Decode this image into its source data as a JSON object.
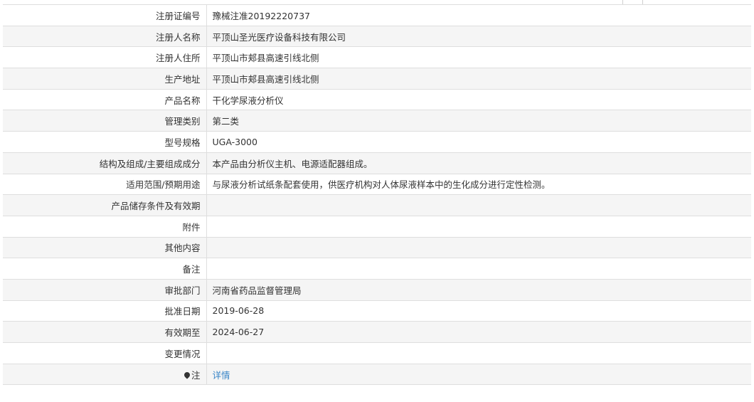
{
  "rows": [
    {
      "label": "注册证编号",
      "value": "豫械注准20192220737"
    },
    {
      "label": "注册人名称",
      "value": "平顶山圣光医疗设备科技有限公司"
    },
    {
      "label": "注册人住所",
      "value": "平顶山市郏县高速引线北侧"
    },
    {
      "label": "生产地址",
      "value": "平顶山市郏县高速引线北侧"
    },
    {
      "label": "产品名称",
      "value": "干化学尿液分析仪"
    },
    {
      "label": "管理类别",
      "value": "第二类"
    },
    {
      "label": "型号规格",
      "value": "UGA-3000"
    },
    {
      "label": "结构及组成/主要组成成分",
      "value": "本产品由分析仪主机、电源适配器组成。"
    },
    {
      "label": "适用范围/预期用途",
      "value": "与尿液分析试纸条配套使用，供医疗机构对人体尿液样本中的生化成分进行定性检测。"
    },
    {
      "label": "产品储存条件及有效期",
      "value": ""
    },
    {
      "label": "附件",
      "value": ""
    },
    {
      "label": "其他内容",
      "value": ""
    },
    {
      "label": "备注",
      "value": ""
    },
    {
      "label": "审批部门",
      "value": "河南省药品监督管理局"
    },
    {
      "label": "批准日期",
      "value": "2019-06-28"
    },
    {
      "label": "有效期至",
      "value": "2024-06-27"
    },
    {
      "label": "变更情况",
      "value": ""
    }
  ],
  "note": {
    "label": "注",
    "icon": "pin-icon",
    "link_text": "详情"
  }
}
